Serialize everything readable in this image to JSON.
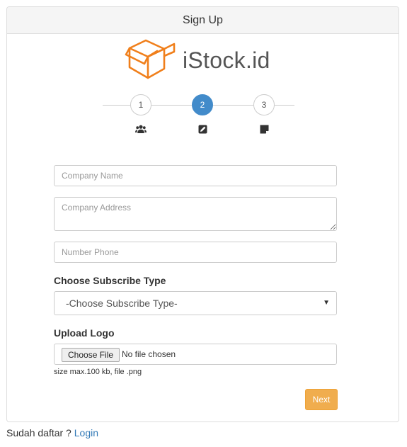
{
  "panel": {
    "title": "Sign Up"
  },
  "brand": {
    "name": "iStock.id",
    "color": "#f07f1b"
  },
  "stepper": {
    "steps": [
      {
        "number": "1",
        "icon": "users-icon",
        "active": false
      },
      {
        "number": "2",
        "icon": "edit-icon",
        "active": true
      },
      {
        "number": "3",
        "icon": "note-icon",
        "active": false
      }
    ],
    "active_color": "#428bca"
  },
  "form": {
    "company_name": {
      "placeholder": "Company Name",
      "value": ""
    },
    "company_address": {
      "placeholder": "Company Address",
      "value": ""
    },
    "phone": {
      "placeholder": "Number Phone",
      "value": ""
    },
    "subscribe": {
      "label": "Choose Subscribe Type",
      "selected": "-Choose Subscribe Type-"
    },
    "logo": {
      "label": "Upload Logo",
      "button": "Choose File",
      "status": "No file chosen",
      "help": "size max.100 kb, file .png"
    },
    "next_label": "Next",
    "next_color": "#f0ad4e"
  },
  "footer": {
    "prompt": "Sudah daftar ?",
    "login_label": "Login",
    "link_color": "#337ab7"
  }
}
